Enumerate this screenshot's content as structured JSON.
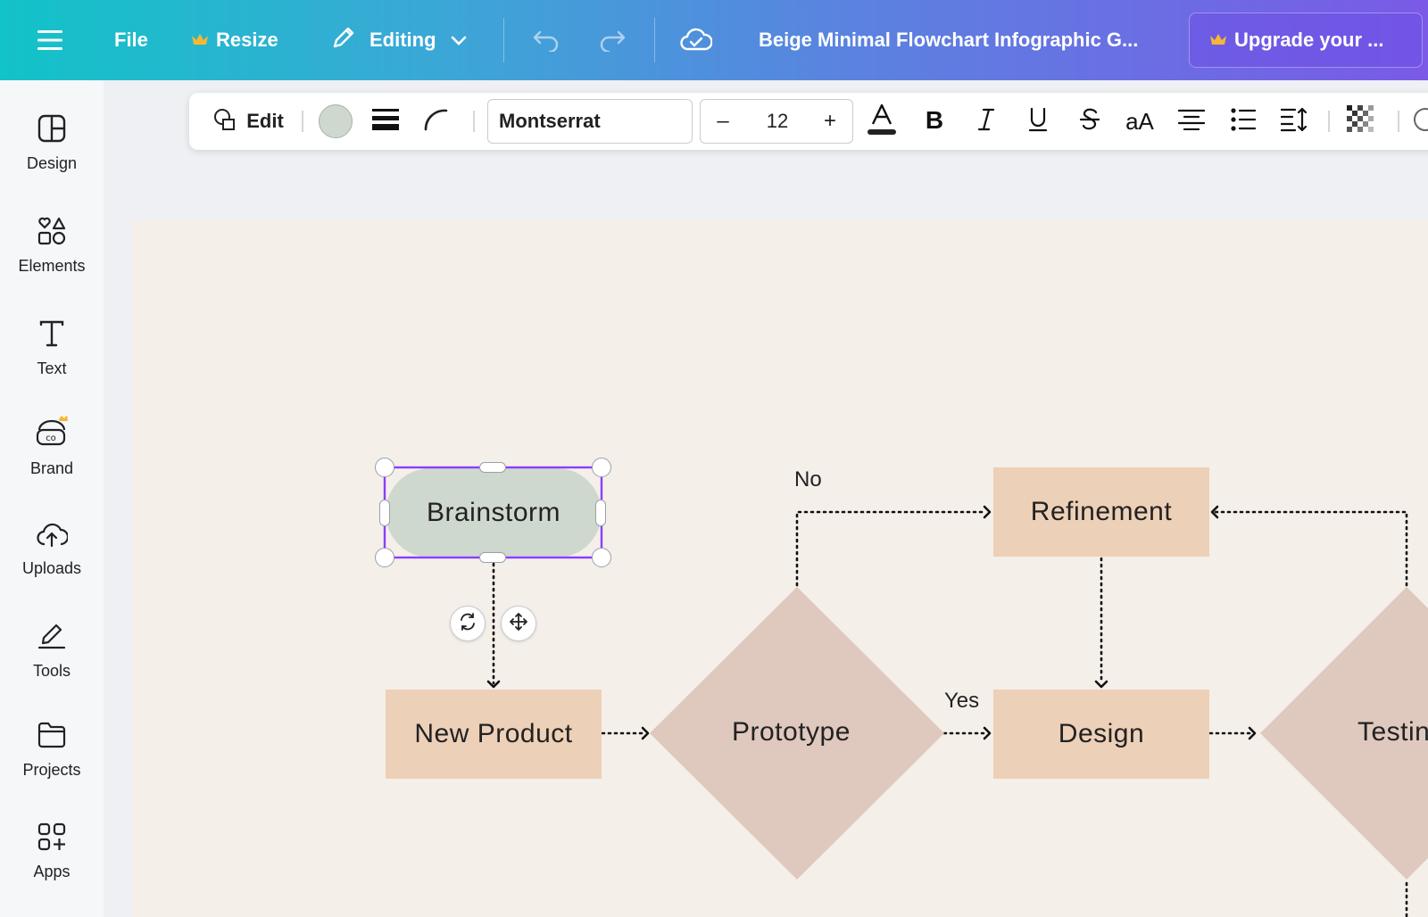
{
  "header": {
    "file_label": "File",
    "resize_label": "Resize",
    "editing_label": "Editing",
    "doc_title": "Beige Minimal Flowchart Infographic G...",
    "upgrade_label": "Upgrade your ..."
  },
  "sidebar": {
    "items": [
      {
        "label": "Design",
        "icon": "design-icon"
      },
      {
        "label": "Elements",
        "icon": "elements-icon"
      },
      {
        "label": "Text",
        "icon": "text-icon"
      },
      {
        "label": "Brand",
        "icon": "brand-icon"
      },
      {
        "label": "Uploads",
        "icon": "uploads-icon"
      },
      {
        "label": "Tools",
        "icon": "tools-icon"
      },
      {
        "label": "Projects",
        "icon": "projects-icon"
      },
      {
        "label": "Apps",
        "icon": "apps-icon"
      }
    ]
  },
  "toolbar": {
    "edit_label": "Edit",
    "font_name": "Montserrat",
    "font_size": "12",
    "minus": "–",
    "plus": "+",
    "case_label": "aA",
    "fill_color": "#cfd8ce"
  },
  "flowchart": {
    "brainstorm": "Brainstorm",
    "new_product": "New Product",
    "prototype": "Prototype",
    "refinement": "Refinement",
    "design": "Design",
    "testing": "Testin",
    "label_no": "No",
    "label_yes": "Yes"
  },
  "colors": {
    "accent_selection": "#8b3dff",
    "peach": "#edd0b8",
    "sage": "#cfd8ce",
    "diamond": "#dfc8bd",
    "canvas": "#f4efe9"
  }
}
